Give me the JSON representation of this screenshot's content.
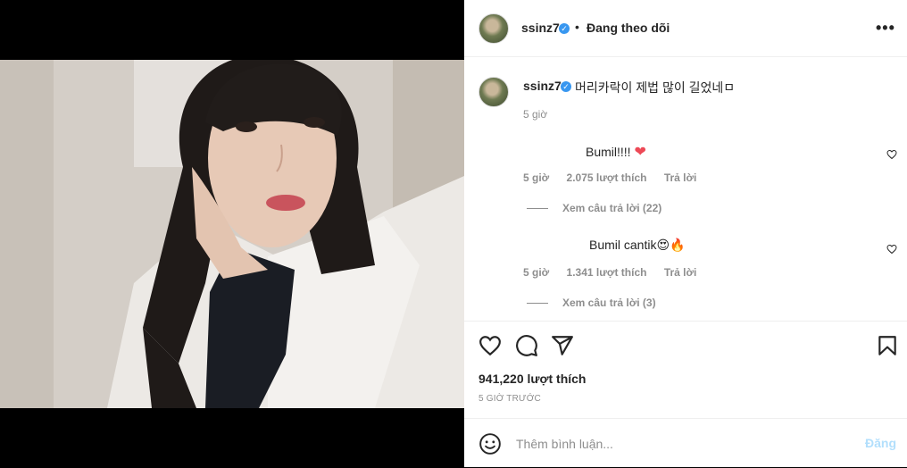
{
  "post": {
    "username": "ssinz7",
    "follow_separator": "•",
    "follow_status": "Đang theo dõi",
    "more_label": "•••",
    "caption": "머리카락이 제법 많이 길었네ㅁ",
    "caption_time": "5 giờ"
  },
  "comments": [
    {
      "text": "Bumil!!!!",
      "emoji": "❤",
      "time": "5 giờ",
      "likes": "2.075 lượt thích",
      "reply_label": "Trả lời",
      "view_replies": "Xem câu trả lời (22)"
    },
    {
      "text": "Bumil cantik",
      "emoji": "😍🔥",
      "time": "5 giờ",
      "likes": "1.341 lượt thích",
      "reply_label": "Trả lời",
      "view_replies": "Xem câu trả lời (3)"
    }
  ],
  "footer": {
    "likes": "941,220 lượt thích",
    "date": "5 GIỜ TRƯỚC"
  },
  "composer": {
    "placeholder": "Thêm bình luận...",
    "post_label": "Đăng"
  },
  "icons": {
    "like": "heart-icon",
    "comment": "comment-icon",
    "share": "share-icon",
    "save": "bookmark-icon",
    "emoji": "emoji-icon",
    "comment_like": "heart-icon",
    "more": "more-icon"
  },
  "colors": {
    "verified": "#3897f0",
    "post_button_disabled": "#b2dffc",
    "secondary_text": "#8e8e8e",
    "heart_red": "#ed4956"
  }
}
